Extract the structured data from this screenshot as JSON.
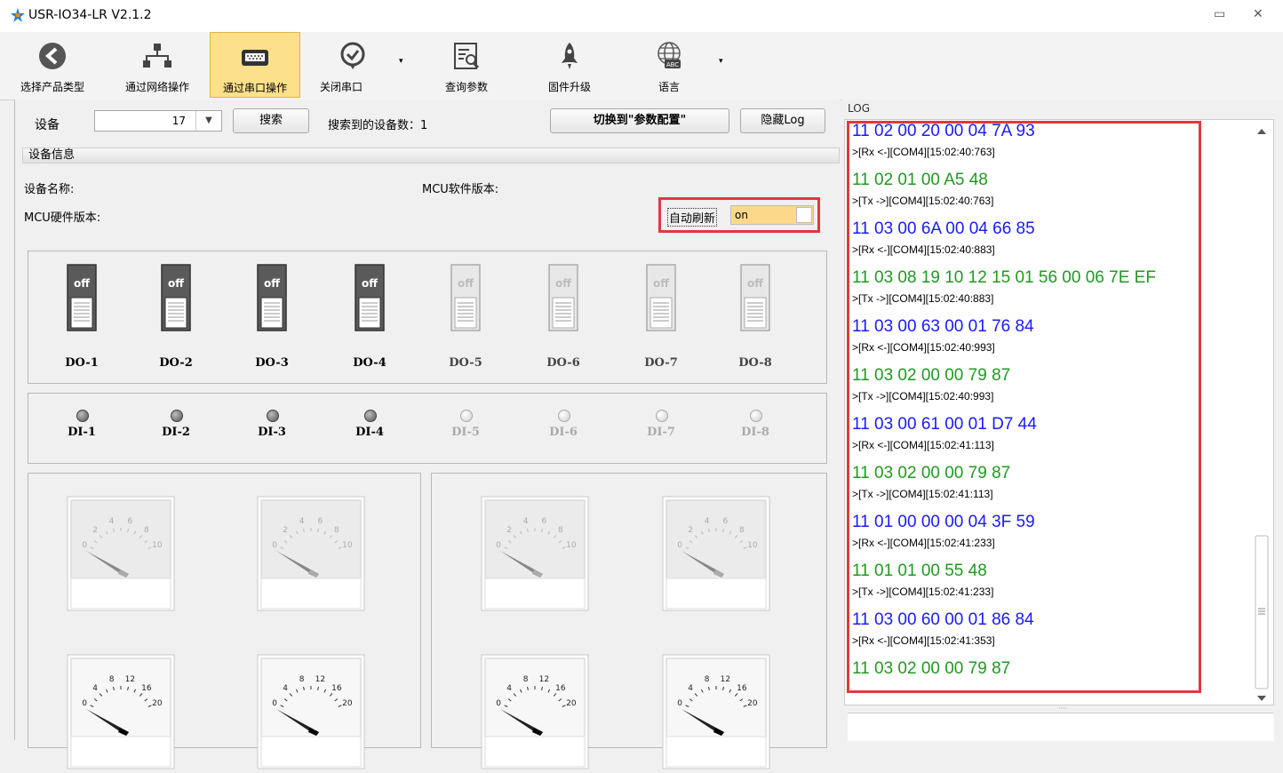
{
  "window": {
    "title": "USR-IO34-LR V2.1.2",
    "min_glyph": "▭",
    "close_glyph": "✕"
  },
  "toolbar": {
    "items": [
      {
        "label": "选择产品类型",
        "icon": "back-arrow-icon"
      },
      {
        "label": "通过网络操作",
        "icon": "network-icon"
      },
      {
        "label": "通过串口操作",
        "icon": "serial-port-icon"
      },
      {
        "label": "关闭串口",
        "icon": "check-circle-icon"
      },
      {
        "label": "查询参数",
        "icon": "query-document-icon"
      },
      {
        "label": "固件升级",
        "icon": "rocket-icon"
      },
      {
        "label": "语言",
        "icon": "globe-abc-icon"
      }
    ],
    "dropdown_glyph": "▾"
  },
  "device_row": {
    "device_label": "设备",
    "device_value": "17",
    "search_label": "搜索",
    "found_label": "搜索到的设备数：1",
    "switch_config_label": "切换到\"参数配置\"",
    "hide_log_label": "隐藏Log"
  },
  "device_info": {
    "header": "设备信息",
    "name_label": "设备名称:",
    "mcu_sw_label": "MCU软件版本:",
    "mcu_hw_label": "MCU硬件版本:",
    "auto_refresh_label": "自动刷新",
    "auto_refresh_value": "on"
  },
  "outputs": [
    {
      "label": "DO-1",
      "state": "off",
      "enabled": true
    },
    {
      "label": "DO-2",
      "state": "off",
      "enabled": true
    },
    {
      "label": "DO-3",
      "state": "off",
      "enabled": true
    },
    {
      "label": "DO-4",
      "state": "off",
      "enabled": true
    },
    {
      "label": "DO-5",
      "state": "off",
      "enabled": false
    },
    {
      "label": "DO-6",
      "state": "off",
      "enabled": false
    },
    {
      "label": "DO-7",
      "state": "off",
      "enabled": false
    },
    {
      "label": "DO-8",
      "state": "off",
      "enabled": false
    }
  ],
  "inputs": [
    {
      "label": "DI-1",
      "enabled": true
    },
    {
      "label": "DI-2",
      "enabled": true
    },
    {
      "label": "DI-3",
      "enabled": true
    },
    {
      "label": "DI-4",
      "enabled": true
    },
    {
      "label": "DI-5",
      "enabled": false
    },
    {
      "label": "DI-6",
      "enabled": false
    },
    {
      "label": "DI-7",
      "enabled": false
    },
    {
      "label": "DI-8",
      "enabled": false
    }
  ],
  "gauges": {
    "top_scale": [
      "0",
      "2",
      "4",
      "6",
      "8",
      "10"
    ],
    "bottom_scale": [
      "0",
      "4",
      "8",
      "12",
      "16",
      "20"
    ]
  },
  "log": {
    "header": "LOG",
    "colors": {
      "tx": "#1a1aff",
      "rx": "#1f9a1f"
    },
    "entries": [
      {
        "kind": "tx",
        "text": "11 02 00 20 00 04 7A 93"
      },
      {
        "kind": "meta",
        "text": ">[Rx <-][COM4][15:02:40:763]"
      },
      {
        "kind": "rx",
        "text": "11 02 01 00 A5 48"
      },
      {
        "kind": "meta",
        "text": ">[Tx ->][COM4][15:02:40:763]"
      },
      {
        "kind": "tx",
        "text": "11 03 00 6A 00 04 66 85"
      },
      {
        "kind": "meta",
        "text": ">[Rx <-][COM4][15:02:40:883]"
      },
      {
        "kind": "rx",
        "text": "11 03 08 19 10 12 15 01 56 00 06 7E EF"
      },
      {
        "kind": "meta",
        "text": ">[Tx ->][COM4][15:02:40:883]"
      },
      {
        "kind": "tx",
        "text": "11 03 00 63 00 01 76 84"
      },
      {
        "kind": "meta",
        "text": ">[Rx <-][COM4][15:02:40:993]"
      },
      {
        "kind": "rx",
        "text": "11 03 02 00 00 79 87"
      },
      {
        "kind": "meta",
        "text": ">[Tx ->][COM4][15:02:40:993]"
      },
      {
        "kind": "tx",
        "text": "11 03 00 61 00 01 D7 44"
      },
      {
        "kind": "meta",
        "text": ">[Rx <-][COM4][15:02:41:113]"
      },
      {
        "kind": "rx",
        "text": "11 03 02 00 00 79 87"
      },
      {
        "kind": "meta",
        "text": ">[Tx ->][COM4][15:02:41:113]"
      },
      {
        "kind": "tx",
        "text": "11 01 00 00 00 04 3F 59"
      },
      {
        "kind": "meta",
        "text": ">[Rx <-][COM4][15:02:41:233]"
      },
      {
        "kind": "rx",
        "text": "11 01 01 00 55 48"
      },
      {
        "kind": "meta",
        "text": ">[Tx ->][COM4][15:02:41:233]"
      },
      {
        "kind": "tx",
        "text": "11 03 00 60 00 01 86 84"
      },
      {
        "kind": "meta",
        "text": ">[Rx <-][COM4][15:02:41:353]"
      },
      {
        "kind": "rx",
        "text": "11 03 02 00 00 79 87"
      }
    ]
  },
  "splitter_glyph": "····"
}
